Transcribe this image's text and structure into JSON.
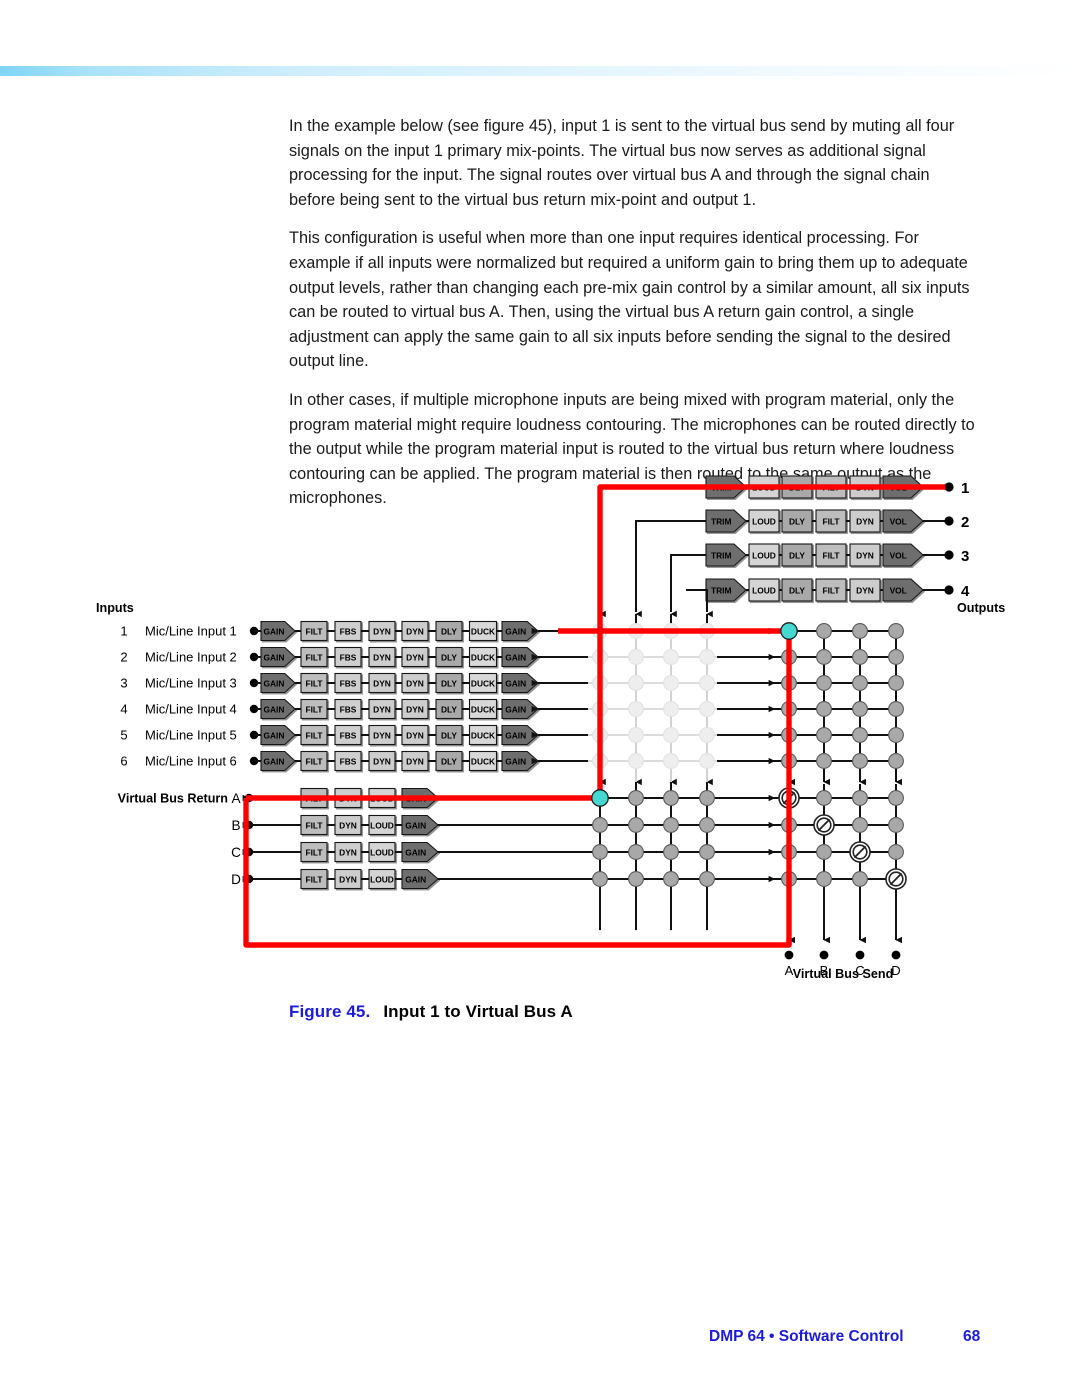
{
  "document": {
    "paragraphs": [
      "In the example below (see figure 45), input 1 is sent to the virtual bus send by muting all four signals on the input 1 primary mix-points. The virtual bus now serves as additional signal processing for the input. The signal routes over virtual bus A and through the signal chain before being sent to the virtual bus return mix-point and output 1.",
      "This configuration is useful when more than one input requires identical processing. For example if all inputs were normalized but required a uniform gain to bring them up to adequate output levels, rather than changing each pre-mix gain control by a similar amount, all six inputs can be routed to virtual bus A. Then, using the virtual bus A return gain control, a single adjustment can apply the same gain to all six inputs before sending the signal to the desired output line.",
      "In other cases, if multiple microphone inputs are being mixed with program material, only the program material might require loudness contouring. The microphones can be routed directly to the output while the program material input is routed to the virtual bus return where loudness contouring can be applied. The program material is then routed to the same output as the microphones."
    ],
    "caption": {
      "number": "Figure 45.",
      "title": "Input 1 to Virtual Bus A"
    },
    "footer": {
      "doc_line": "DMP 64 • Software Control",
      "page_number": "68"
    }
  },
  "figure": {
    "labels": {
      "inputs_heading": "Inputs",
      "outputs_heading": "Outputs",
      "virtual_bus_return": "Virtual Bus Return",
      "virtual_bus_send": "Virtual Bus Send"
    },
    "input_rows": [
      {
        "number": "1",
        "name": "Mic/Line Input 1"
      },
      {
        "number": "2",
        "name": "Mic/Line Input 2"
      },
      {
        "number": "3",
        "name": "Mic/Line Input 3"
      },
      {
        "number": "4",
        "name": "Mic/Line Input 4"
      },
      {
        "number": "5",
        "name": "Mic/Line Input 5"
      },
      {
        "number": "6",
        "name": "Mic/Line Input 6"
      }
    ],
    "input_chain_blocks": [
      "GAIN",
      "FILT",
      "FBS",
      "DYN",
      "DYN",
      "DLY",
      "DUCK",
      "GAIN"
    ],
    "virtual_bus_return_rows": [
      "A",
      "B",
      "C",
      "D"
    ],
    "virtual_bus_return_chain_blocks": [
      "FILT",
      "DYN",
      "LOUD",
      "GAIN"
    ],
    "output_rows": [
      "1",
      "2",
      "3",
      "4"
    ],
    "output_chain_blocks": [
      "TRIM",
      "LOUD",
      "DLY",
      "FILT",
      "DYN",
      "VOL"
    ],
    "virtual_bus_send_columns": [
      "A",
      "B",
      "C",
      "D"
    ],
    "colors": {
      "signal_path": "#ff0000",
      "active_crosspoint": "#45d8d0",
      "crosspoint_normal": "#a8a8a8",
      "crosspoint_muted_light": "#eeeeee",
      "block_dark": "#6b6b6b",
      "block_light": "#d0d0d0",
      "block_mid": "#b4b4b4",
      "caption_accent": "#1b1bdc"
    }
  },
  "chart_data": {
    "type": "diagram",
    "title": "Input 1 to Virtual Bus A",
    "description": "DMP 64 signal routing matrix. Six Mic/Line inputs each pass through a processing chain, then reach a crosspoint matrix. Four virtual bus send columns (A-D) and four output columns (1-4). Four virtual bus returns (A-D) each pass through a return chain and feed the same matrix. The highlighted red signal path shows input 1 routed to virtual bus send A, through the virtual bus return A chain, and into output 1.",
    "matrix": {
      "row_groups": [
        {
          "group": "inputs",
          "rows": [
            "1",
            "2",
            "3",
            "4",
            "5",
            "6"
          ]
        },
        {
          "group": "virtual_bus_returns",
          "rows": [
            "A",
            "B",
            "C",
            "D"
          ]
        }
      ],
      "column_groups": [
        {
          "group": "virtual_bus_send",
          "columns": [
            "A",
            "B",
            "C",
            "D"
          ]
        },
        {
          "group": "outputs",
          "columns": [
            "1",
            "2",
            "3",
            "4"
          ]
        }
      ],
      "crosspoint_states": {
        "inputs_to_virtual_bus_send": "muted-light",
        "inputs_to_outputs": "normal",
        "returns_to_virtual_bus_send": "normal",
        "returns_to_outputs": "normal",
        "input1_to_send_A": "active",
        "returnA_to_output1": "active",
        "diagonal_return_to_output": "muted-slash"
      }
    }
  }
}
